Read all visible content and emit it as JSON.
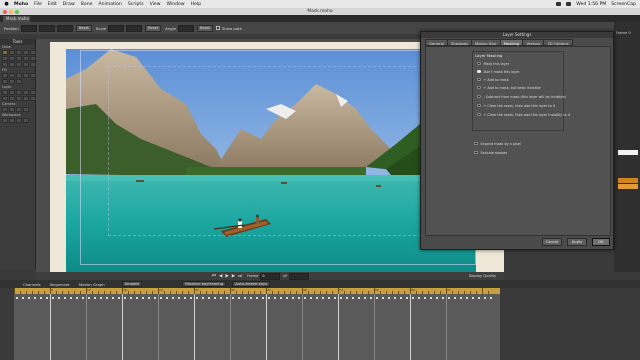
{
  "menubar": {
    "app": "Moho",
    "items": [
      "File",
      "Edit",
      "Draw",
      "Bone",
      "Animation",
      "Scripts",
      "View",
      "Window",
      "Help"
    ],
    "clock": "Wed 1:56 PM",
    "right_app": "ScreenCap"
  },
  "window": {
    "title": "Mask.moho"
  },
  "doc_tab": {
    "label": "Mask.moho"
  },
  "options_bar": {
    "position_label": "Position",
    "scale_label": "Scale",
    "angle_label": "Angle",
    "reset_1": "Reset",
    "reset_2": "Reset",
    "reset_3": "Reset",
    "show_path_label": "Show path"
  },
  "tools": {
    "title": "Tools",
    "sections": [
      "Draw",
      "Fill",
      "Layer",
      "Camera",
      "Workspace"
    ]
  },
  "right_panel": {
    "items": [
      "Frame 0"
    ]
  },
  "dialog": {
    "title": "Layer Settings",
    "tabs": [
      {
        "label": "General",
        "active": false
      },
      {
        "label": "Shadows",
        "active": false
      },
      {
        "label": "Motion Blur",
        "active": false
      },
      {
        "label": "Masking",
        "active": true
      },
      {
        "label": "Vectors",
        "active": false
      },
      {
        "label": "3D Options",
        "active": false
      }
    ],
    "group_title": "Layer Masking",
    "radio_options": [
      {
        "label": "Mask this layer",
        "selected": false
      },
      {
        "label": "Don't mask this layer",
        "selected": true
      },
      {
        "label": "+ Add to mask",
        "selected": false
      },
      {
        "label": "+ Add to mask, but keep invisible",
        "selected": false
      },
      {
        "label": "- Subtract from mask (this layer will be invisible)",
        "selected": false
      },
      {
        "label": "+ Clear the mask, then add this layer to it",
        "selected": false
      },
      {
        "label": "+ Clear the mask, then add this layer invisibly to it",
        "selected": false
      }
    ],
    "checkboxes": [
      {
        "label": "Expand mask by a pixel",
        "checked": false
      },
      {
        "label": "Exclude strokes",
        "checked": false
      }
    ],
    "buttons": {
      "cancel": "Cancel",
      "apply": "Apply",
      "ok": "OK"
    }
  },
  "playbar": {
    "frame_label": "Frame",
    "frame_value": "0",
    "of_label": "of",
    "display_quality": "Display Quality"
  },
  "timeline": {
    "tabs": [
      "Channels",
      "Sequencer",
      "Motion Graph"
    ],
    "smooth_label": "Smooth",
    "relative_keyframing": "Relative keyframing",
    "auto_freeze_keys": "Auto-freeze keys",
    "ruler_numbers": [
      "6",
      "12",
      "18",
      "24",
      "30",
      "36",
      "42",
      "48",
      "54",
      "60",
      "66",
      "72"
    ]
  },
  "colors": {
    "ruler": "#c8a040",
    "accent_tool": "#8a6a2a"
  }
}
